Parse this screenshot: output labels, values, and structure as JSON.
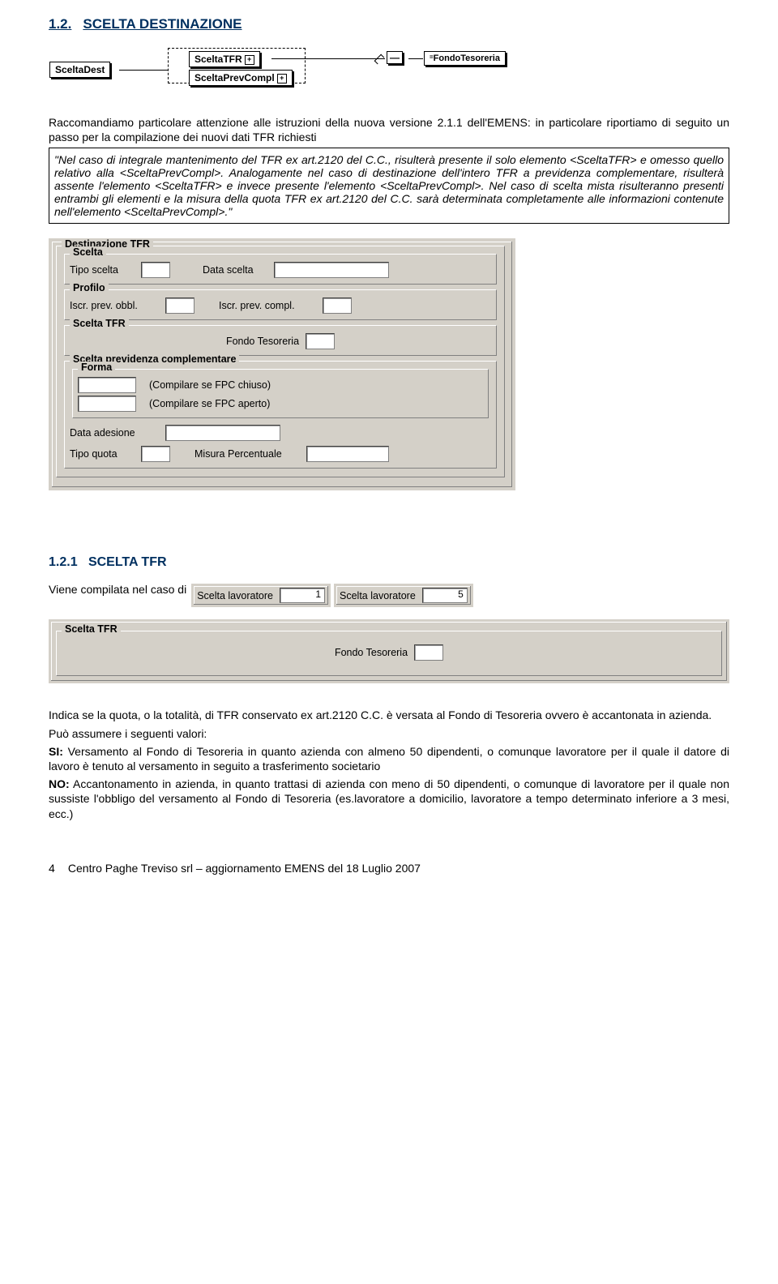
{
  "heading": {
    "number": "1.2.",
    "title": "SCELTA DESTINAZIONE"
  },
  "diagram": {
    "sceltadest": "SceltaDest",
    "sceltatfr": "SceltaTFR",
    "sceltaprev": "SceltaPrevCompl",
    "fondo": "FondoTesoreria"
  },
  "intro_1": "Raccomandiamo particolare attenzione alle istruzioni della nuova versione 2.1.1 dell'EMENS: in particolare riportiamo di seguito un passo per la compilazione dei nuovi dati TFR richiesti",
  "infobox": "\"Nel caso di integrale mantenimento del TFR ex art.2120 del C.C., risulterà presente il solo elemento <SceltaTFR> e omesso quello relativo alla <SceltaPrevCompl>. Analogamente nel caso di destinazione dell'intero TFR a previdenza complementare, risulterà assente l'elemento <SceltaTFR> e invece presente l'elemento <SceltaPrevCompl>. Nel caso di scelta mista risulteranno presenti entrambi gli elementi e la misura della quota TFR ex art.2120 del C.C. sarà determinata completamente alle informazioni contenute nell'elemento <SceltaPrevCompl>.\"",
  "form_large": {
    "dest_legend": "Destinazione TFR",
    "scelta_legend": "Scelta",
    "tipo_scelta": "Tipo scelta",
    "data_scelta": "Data scelta",
    "profilo_legend": "Profilo",
    "iscr_obbl": "Iscr. prev. obbl.",
    "iscr_compl": "Iscr. prev. compl.",
    "scelta_tfr_legend": "Scelta TFR",
    "fondo_tesoreria": "Fondo Tesoreria",
    "scelta_prev_legend": "Scelta previdenza complementare",
    "forma_legend": "Forma",
    "fpc_chiuso": "(Compilare se FPC chiuso)",
    "fpc_aperto": "(Compilare se FPC aperto)",
    "data_adesione": "Data adesione",
    "tipo_quota": "Tipo quota",
    "misura_perc": "Misura Percentuale"
  },
  "subheading": {
    "number": "1.2.1",
    "title": "SCELTA TFR"
  },
  "inline": {
    "text": "Viene compilata nel caso di",
    "scelta_lav": "Scelta lavoratore",
    "val1": "1",
    "val5": "5"
  },
  "second_ui": {
    "scelta_tfr_legend": "Scelta TFR",
    "fondo_tesoreria": "Fondo Tesoreria"
  },
  "body2_p1": "Indica se la quota, o la totalità, di TFR conservato ex art.2120 C.C. è versata al Fondo di Tesoreria ovvero è accantonata in azienda.",
  "body2_p2_lead": "Può assumere i seguenti valori:",
  "body2_si_label": "SI:",
  "body2_si": " Versamento al Fondo di Tesoreria in quanto azienda con almeno 50 dipendenti, o comunque lavoratore per il quale il datore di lavoro è tenuto al versamento in seguito a trasferimento societario",
  "body2_no_label": "NO:",
  "body2_no": " Accantonamento in azienda, in quanto trattasi di azienda con meno di 50 dipendenti, o comunque di lavoratore per il quale non sussiste l'obbligo del versamento al Fondo di Tesoreria (es.lavoratore a domicilio, lavoratore a tempo determinato inferiore a 3 mesi, ecc.)",
  "footer": {
    "page": "4",
    "text": "Centro Paghe Treviso srl – aggiornamento EMENS del 18 Luglio 2007"
  }
}
